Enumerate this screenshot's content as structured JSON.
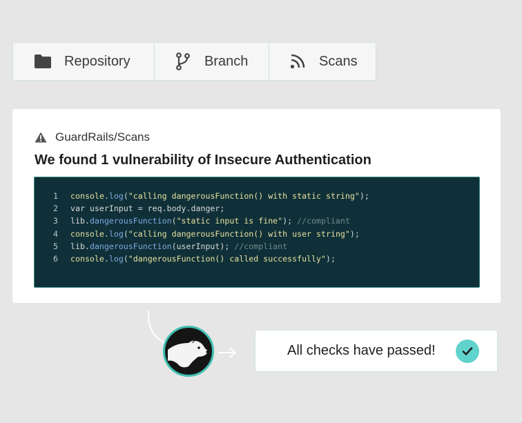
{
  "tabs": [
    {
      "label": "Repository",
      "icon": "folder-icon"
    },
    {
      "label": "Branch",
      "icon": "branch-icon"
    },
    {
      "label": "Scans",
      "icon": "rss-icon"
    }
  ],
  "card": {
    "breadcrumb": "GuardRails/Scans",
    "heading": "We found 1 vulnerability of Insecure Authentication",
    "code_lines": [
      {
        "n": "1",
        "parts": [
          [
            "obj",
            "console"
          ],
          [
            "plain",
            "."
          ],
          [
            "fn",
            "log"
          ],
          [
            "plain",
            "("
          ],
          [
            "str",
            "\"calling dangerousFunction() with static string\""
          ],
          [
            "plain",
            ");"
          ]
        ]
      },
      {
        "n": "2",
        "parts": [
          [
            "plain",
            "var userInput = req.body.danger;"
          ]
        ]
      },
      {
        "n": "3",
        "parts": [
          [
            "plain",
            "lib."
          ],
          [
            "fn",
            "dangerousFunction"
          ],
          [
            "plain",
            "("
          ],
          [
            "str",
            "\"static input is fine\""
          ],
          [
            "plain",
            "); "
          ],
          [
            "cm",
            "//compliant"
          ]
        ]
      },
      {
        "n": "4",
        "parts": [
          [
            "obj",
            "console"
          ],
          [
            "plain",
            "."
          ],
          [
            "fn",
            "log"
          ],
          [
            "plain",
            "("
          ],
          [
            "str",
            "\"calling dangerousFunction() with user string\""
          ],
          [
            "plain",
            ");"
          ]
        ]
      },
      {
        "n": "5",
        "parts": [
          [
            "plain",
            "lib."
          ],
          [
            "fn",
            "dangerousFunction"
          ],
          [
            "plain",
            "(userInput); "
          ],
          [
            "cm",
            "//compliant"
          ]
        ]
      },
      {
        "n": "6",
        "parts": [
          [
            "obj",
            "console"
          ],
          [
            "plain",
            "."
          ],
          [
            "fn",
            "log"
          ],
          [
            "plain",
            "("
          ],
          [
            "str",
            "\"dangerousFunction() called successfully\""
          ],
          [
            "plain",
            ");"
          ]
        ]
      }
    ]
  },
  "result": {
    "message": "All checks have passed!"
  },
  "colors": {
    "accent": "#5fd3cc",
    "code_bg": "#0f3038",
    "border": "#cfe3de"
  }
}
